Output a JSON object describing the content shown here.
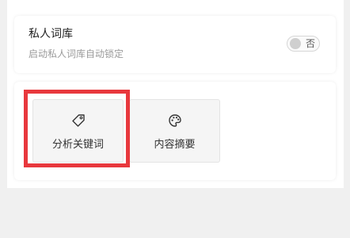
{
  "lexicon": {
    "title": "私人词库",
    "subtitle": "启动私人词库自动锁定",
    "toggle_label": "否"
  },
  "tools": [
    {
      "label": "分析关键词",
      "icon": "tag-icon"
    },
    {
      "label": "内容摘要",
      "icon": "palette-icon"
    }
  ],
  "colors": {
    "highlight": "#e8383d",
    "background": "#f0f0f0"
  }
}
